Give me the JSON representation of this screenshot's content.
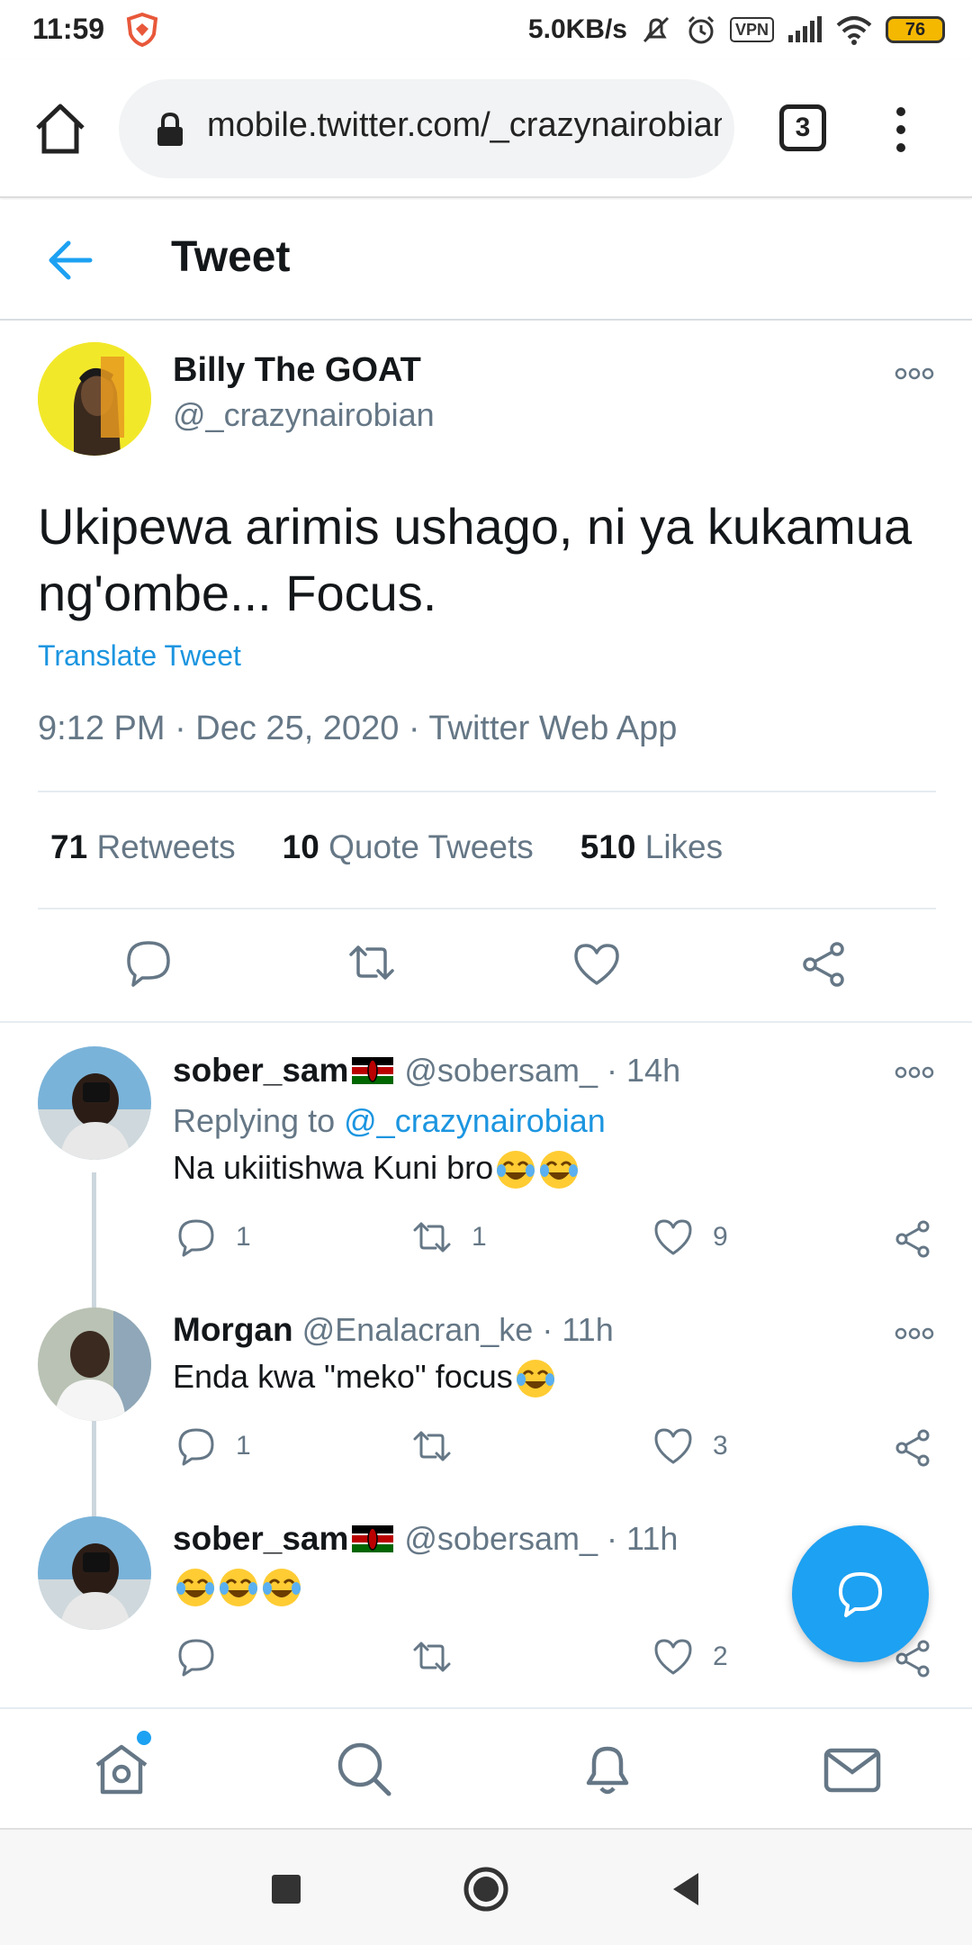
{
  "status_bar": {
    "time": "11:59",
    "net_speed": "5.0KB/s",
    "vpn": "VPN",
    "battery": "76"
  },
  "browser": {
    "url": "mobile.twitter.com/_crazynairobian",
    "tab_count": "3"
  },
  "header": {
    "title": "Tweet"
  },
  "tweet": {
    "author_name": "Billy The GOAT",
    "author_handle": "@_crazynairobian",
    "text": "Ukipewa arimis ushago, ni ya kukamua ng'ombe... Focus.",
    "translate": "Translate Tweet",
    "meta": "9:12 PM · Dec 25, 2020 · Twitter Web App",
    "stats": {
      "retweets_count": "71",
      "retweets_label": "Retweets",
      "quotes_count": "10",
      "quotes_label": "Quote Tweets",
      "likes_count": "510",
      "likes_label": "Likes"
    }
  },
  "replies": [
    {
      "name": "sober_sam",
      "handle": "@sobersam_",
      "time": "· 14h",
      "replying_prefix": "Replying to",
      "replying_handle": "@_crazynairobian",
      "text": "Na ukiitishwa Kuni bro",
      "reply_count": "1",
      "retweet_count": "1",
      "like_count": "9"
    },
    {
      "name": "Morgan",
      "handle": "@Enalacran_ke",
      "time": "· 11h",
      "text": "Enda kwa \"meko\" focus",
      "reply_count": "1",
      "retweet_count": "",
      "like_count": "3"
    },
    {
      "name": "sober_sam",
      "handle": "@sobersam_",
      "time": "· 11h",
      "text": "",
      "reply_count": "",
      "retweet_count": "",
      "like_count": "2"
    }
  ],
  "colors": {
    "accent": "#1da1f2",
    "link": "#1b95e0",
    "secondary_text": "#657786"
  }
}
